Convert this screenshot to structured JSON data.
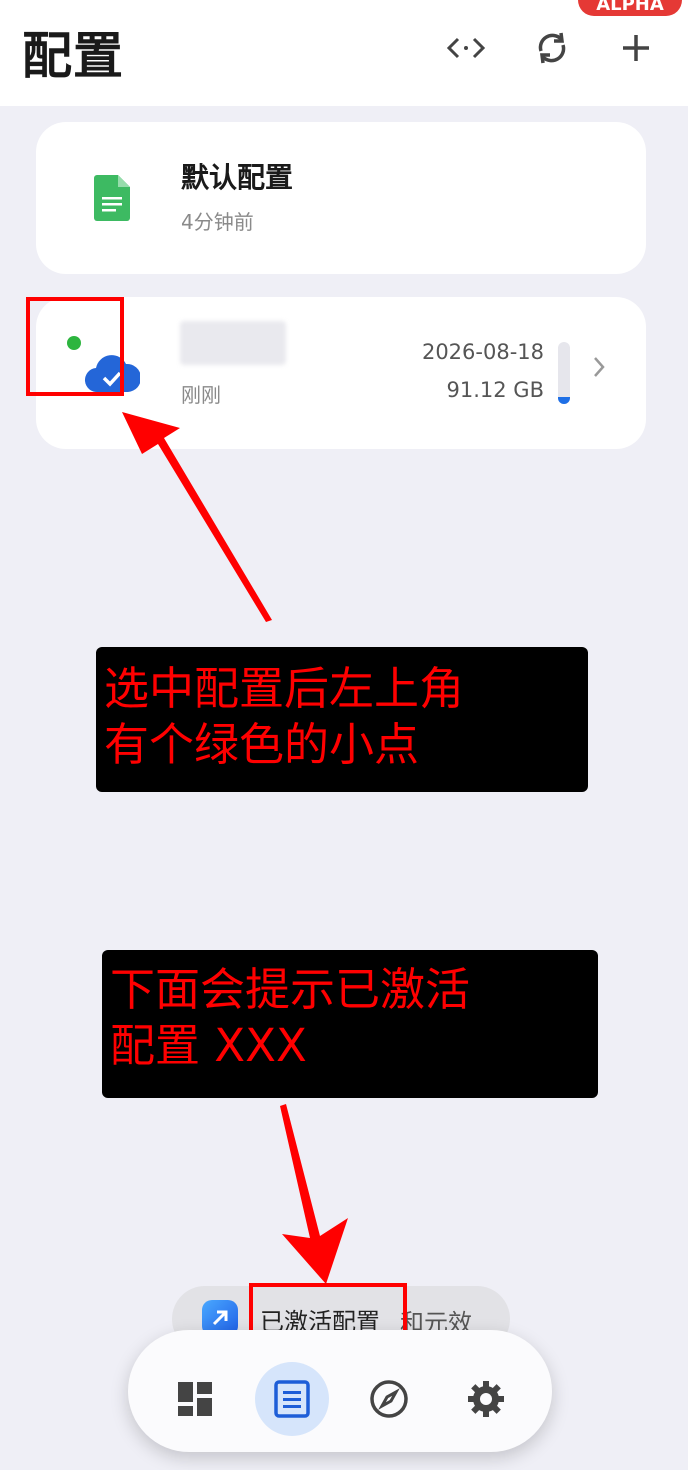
{
  "header": {
    "title": "配置",
    "badge": "ALPHA"
  },
  "profiles": [
    {
      "name": "默认配置",
      "subtitle": "4分钟前"
    },
    {
      "name": "",
      "subtitle": "刚刚",
      "expire_date": "2026-08-18",
      "traffic": "91.12 GB",
      "usage_fraction": 0.12
    }
  ],
  "annotations": {
    "note1_line1": "选中配置后左上角",
    "note1_line2": "有个绿色的小点",
    "note2_line1": "下面会提示已激活",
    "note2_line2": "配置 XXX"
  },
  "toast": {
    "text": "已激活配置",
    "tail": "和元效"
  },
  "colors": {
    "accent": "#1e6fe6",
    "active_dot": "#2db53f",
    "annotation": "#ff0000",
    "alpha_badge": "#e53935"
  }
}
